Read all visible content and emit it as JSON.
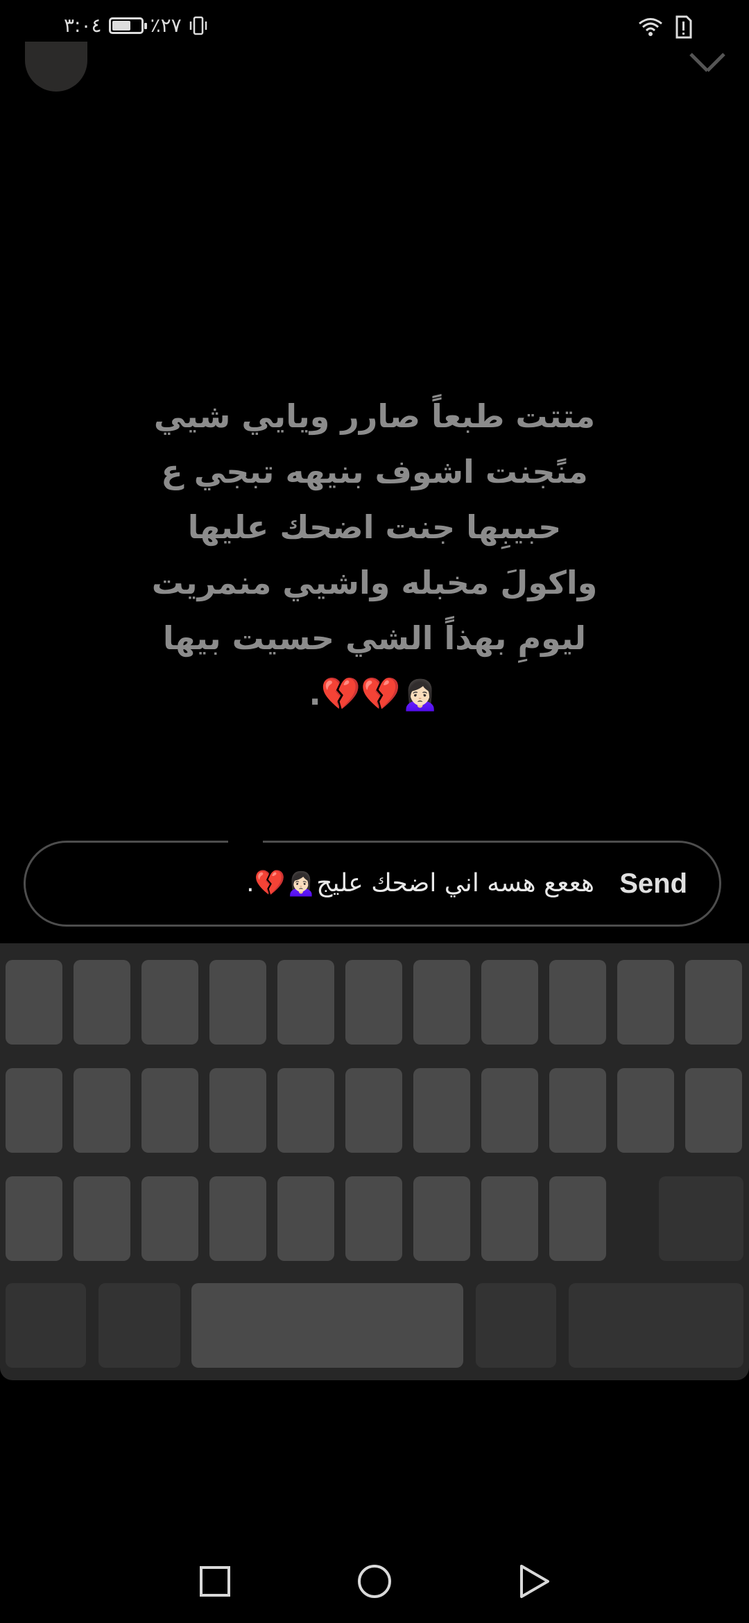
{
  "status_bar": {
    "time": "٣:٠٤",
    "battery_level": 0.6,
    "battery_text": "٪٢٧"
  },
  "story": {
    "lines": [
      "متتت طبعاً صارر ويايي شيي",
      "منًجنت اشوف بنيهه تبجي ع",
      "حبيبِها جنت اضحك عليها",
      "واكولَ مخبله واشيي منمريت",
      "ليومِ بهذاً الشي حسيت بيها",
      "🙍🏻‍♀️💔💔."
    ]
  },
  "reply": {
    "text": "هععع هسه اني اضحك عليج🙍🏻‍♀️💔.",
    "send_label": "Send"
  },
  "colors": {
    "background": "#000000",
    "story_text": "#8c8c8c",
    "keyboard_bg": "#272727",
    "key": "#4a4a4a",
    "key_dark": "#333333"
  },
  "icons": {
    "status": [
      "battery-icon",
      "vibrate-icon",
      "wifi-icon",
      "alert-icon"
    ],
    "header": [
      "avatar",
      "close-icon"
    ],
    "nav": [
      "recents-icon",
      "home-icon",
      "back-icon"
    ]
  }
}
